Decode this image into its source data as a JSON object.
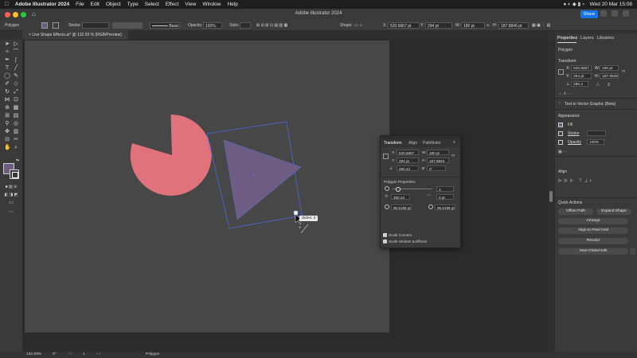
{
  "menubar": {
    "app": "Adobe Illustrator 2024",
    "items": [
      "File",
      "Edit",
      "Object",
      "Type",
      "Select",
      "Effect",
      "View",
      "Window",
      "Help"
    ],
    "datetime": "Wed 20 Mar 15:08"
  },
  "titlebar": {
    "title": "Adobe Illustrator 2024",
    "share": "Share"
  },
  "controlbar": {
    "selection": "Polygon",
    "stroke_label": "Stroke:",
    "brush": "Basic",
    "opacity_label": "Opacity:",
    "opacity": "100%",
    "style_label": "Style:",
    "shape_label": "Shape:",
    "x_label": "X:",
    "x": "520.6667 pt",
    "y_label": "Y:",
    "y": "294 pt",
    "w_label": "W:",
    "w": "180 pt",
    "h_label": "H:",
    "h": "187.8846 pt"
  },
  "document_tab": "Live Shape Effects.ai* @ 132.93 % (RGB/Preview)",
  "canvas": {
    "tooltip": "Sides: 3",
    "colors": {
      "pie": "#e0727c",
      "triangle": "#6e5c82",
      "bbox": "#4a68d6"
    }
  },
  "transform_panel": {
    "tabs": [
      "Transform",
      "Align",
      "Pathfinder"
    ],
    "x_label": "X:",
    "x": "520.6667 pt",
    "w_label": "W:",
    "w": "180 pt",
    "y_label": "Y:",
    "y": "294 pt",
    "h_label": "H:",
    "h": "187.8846 pt",
    "angle": "280.42",
    "shear": "0°",
    "section": "Polygon Properties:",
    "sides": "3",
    "rotation": "280.42",
    "corner": "0 pt",
    "radius": "95.5196 pt",
    "side_length": "95.5196 pt",
    "scale_corners": "Scale Corners",
    "scale_strokes": "Scale Strokes & Effects"
  },
  "properties": {
    "tabs": [
      "Properties",
      "Layers",
      "Libraries"
    ],
    "object": "Polygon",
    "transform_title": "Transform",
    "x_label": "X:",
    "x": "520.6667",
    "w_label": "W:",
    "w": "180 pt",
    "y_label": "Y:",
    "y": "294 pt",
    "h_label": "H:",
    "h": "187.8846",
    "angle": "280.4",
    "sides": "3",
    "text_vector": "Text to Vector Graphic (Beta)",
    "appearance_title": "Appearance",
    "fill": "Fill",
    "stroke": "Stroke",
    "opacity_label": "Opacity",
    "opacity": "100%",
    "align_title": "Align",
    "quick_title": "Quick Actions",
    "offset_path": "Offset Path",
    "expand_shape": "Expand Shape",
    "arrange": "Arrange",
    "align_pixel": "Align to Pixel Grid",
    "recolor": "Recolor",
    "global_edit": "Start Global Edit"
  },
  "status": {
    "zoom": "132.93%",
    "angle": "0°",
    "page": "1",
    "tool": "Polygon"
  }
}
